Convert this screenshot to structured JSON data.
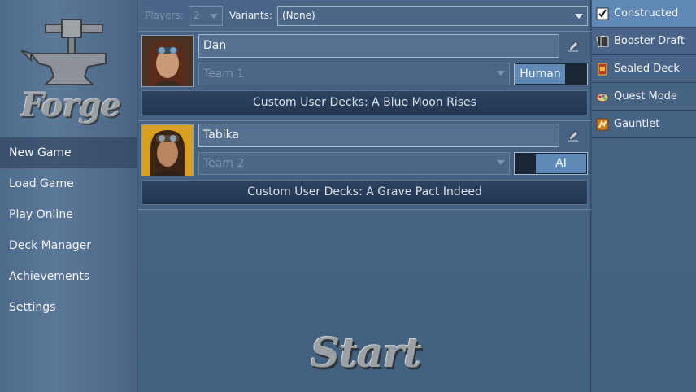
{
  "nav": {
    "items": [
      {
        "label": "New Game",
        "active": true
      },
      {
        "label": "Load Game",
        "active": false
      },
      {
        "label": "Play Online",
        "active": false
      },
      {
        "label": "Deck Manager",
        "active": false
      },
      {
        "label": "Achievements",
        "active": false
      },
      {
        "label": "Settings",
        "active": false
      }
    ]
  },
  "logo": {
    "text": "Forge"
  },
  "topbar": {
    "players_label": "Players:",
    "players_value": "2",
    "variants_label": "Variants:",
    "variants_value": "(None)"
  },
  "players": [
    {
      "name": "Dan",
      "team": "Team 1",
      "toggle": "Human",
      "deck": "Custom User Decks: A Blue Moon Rises"
    },
    {
      "name": "Tabika",
      "team": "Team 2",
      "toggle": "AI",
      "deck": "Custom User Decks: A Grave Pact Indeed"
    }
  ],
  "start": {
    "label": "Start"
  },
  "modes": [
    {
      "label": "Constructed",
      "icon": "checkbox-icon",
      "active": true
    },
    {
      "label": "Booster Draft",
      "icon": "card-pack-icon",
      "active": false
    },
    {
      "label": "Sealed Deck",
      "icon": "sealed-deck-icon",
      "active": false
    },
    {
      "label": "Quest Mode",
      "icon": "quest-icon",
      "active": false
    },
    {
      "label": "Gauntlet",
      "icon": "gauntlet-icon",
      "active": false
    }
  ],
  "colors": {
    "accent": "#5f8ab8",
    "panel": "#42607f",
    "deck_bar": "#223650"
  }
}
